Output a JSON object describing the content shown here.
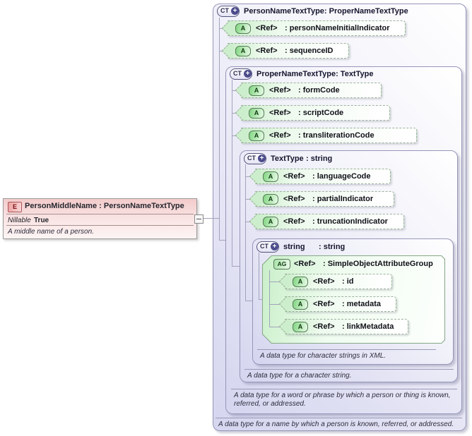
{
  "icons": {
    "element": "E",
    "complex_type": "CT",
    "attribute": "A",
    "attribute_group": "AG",
    "expand": "+"
  },
  "element": {
    "title": "PersonMiddleName : PersonNameTextType",
    "property_name": "Nillable",
    "property_value": "True",
    "annotation": "A middle name of a person."
  },
  "person_name_text_type": {
    "name": "PersonNameTextType",
    "base": ": ProperNameTextType",
    "attributes": [
      {
        "ref": "<Ref>",
        "name": ": personNameInitialIndicator"
      },
      {
        "ref": "<Ref>",
        "name": ": sequenceID"
      }
    ],
    "annotation": "A data type for a name by which a person is known, referred, or addressed."
  },
  "proper_name_text_type": {
    "name": "ProperNameTextType",
    "base": ": TextType",
    "attributes": [
      {
        "ref": "<Ref>",
        "name": ": formCode"
      },
      {
        "ref": "<Ref>",
        "name": ": scriptCode"
      },
      {
        "ref": "<Ref>",
        "name": ": transliterationCode"
      }
    ],
    "annotation": "A data type for a word or phrase by which a person or thing is known, referred, or addressed."
  },
  "text_type": {
    "name": "TextType",
    "base": ": string",
    "attributes": [
      {
        "ref": "<Ref>",
        "name": ": languageCode"
      },
      {
        "ref": "<Ref>",
        "name": ": partialIndicator"
      },
      {
        "ref": "<Ref>",
        "name": ": truncationIndicator"
      }
    ],
    "annotation": "A data type for a character string."
  },
  "string_type": {
    "name": "string",
    "base": ": string",
    "attribute_group": {
      "ref": "<Ref>",
      "name": ": SimpleObjectAttributeGroup",
      "attributes": [
        {
          "ref": "<Ref>",
          "name": ": id"
        },
        {
          "ref": "<Ref>",
          "name": ": metadata"
        },
        {
          "ref": "<Ref>",
          "name": ": linkMetadata"
        }
      ]
    },
    "annotation": "A data type for character strings in XML."
  }
}
